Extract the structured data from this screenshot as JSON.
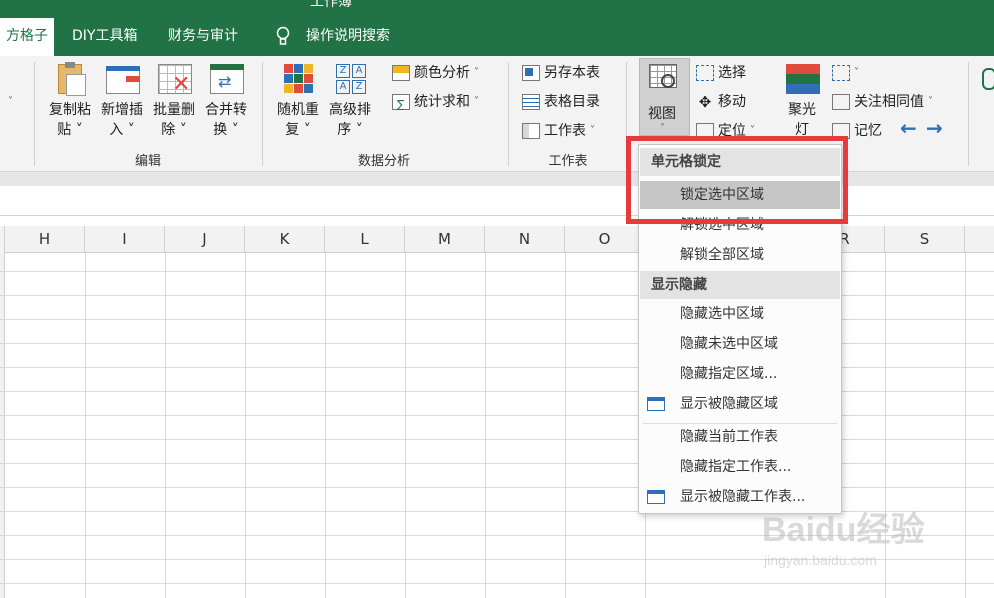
{
  "title": "工作簿",
  "tabs": [
    {
      "label": "方格子",
      "active": true
    },
    {
      "label": "DIY工具箱",
      "active": false
    },
    {
      "label": "财务与审计",
      "active": false
    },
    {
      "label": "操作说明搜索",
      "active": false
    }
  ],
  "ribbon": {
    "edit_group": {
      "label": "编辑",
      "buttons": [
        {
          "line1": "复制粘",
          "line2": "贴 ˅"
        },
        {
          "line1": "新增插",
          "line2": "入 ˅"
        },
        {
          "line1": "批量删",
          "line2": "除 ˅"
        },
        {
          "line1": "合并转",
          "line2": "换 ˅"
        }
      ]
    },
    "data_group": {
      "label": "数据分析",
      "buttons": [
        {
          "line1": "随机重",
          "line2": "复 ˅"
        },
        {
          "line1": "高级排",
          "line2": "序 ˅"
        }
      ],
      "small": [
        "颜色分析",
        "统计求和"
      ]
    },
    "sheet_group": {
      "label": "工作表",
      "small": [
        "另存本表",
        "表格目录",
        "工作表"
      ]
    },
    "view_group": {
      "view_label": "视图",
      "small": [
        "选择",
        "移动",
        "定位"
      ],
      "spotlight_line1": "聚光",
      "spotlight_line2": "灯",
      "extra": [
        "关注相同值",
        "记忆"
      ]
    }
  },
  "columns": [
    "H",
    "I",
    "J",
    "K",
    "L",
    "M",
    "N",
    "O",
    "R",
    "S"
  ],
  "menu": {
    "section1": "单元格锁定",
    "lock_selected": "锁定选中区域",
    "unlock_selected": "解锁选中区域",
    "unlock_all": "解锁全部区域",
    "section2": "显示隐藏",
    "hide_selected": "隐藏选中区域",
    "hide_unselected": "隐藏未选中区域",
    "hide_specified": "隐藏指定区域...",
    "show_hidden": "显示被隐藏区域",
    "hide_current_sheet": "隐藏当前工作表",
    "hide_specified_sheet": "隐藏指定工作表...",
    "show_hidden_sheet": "显示被隐藏工作表..."
  },
  "watermark": {
    "brand": "Baidu经验",
    "url": "jingyan.baidu.com"
  },
  "colors": {
    "accent": "#217346",
    "highlight_border": "#e63b3b"
  }
}
